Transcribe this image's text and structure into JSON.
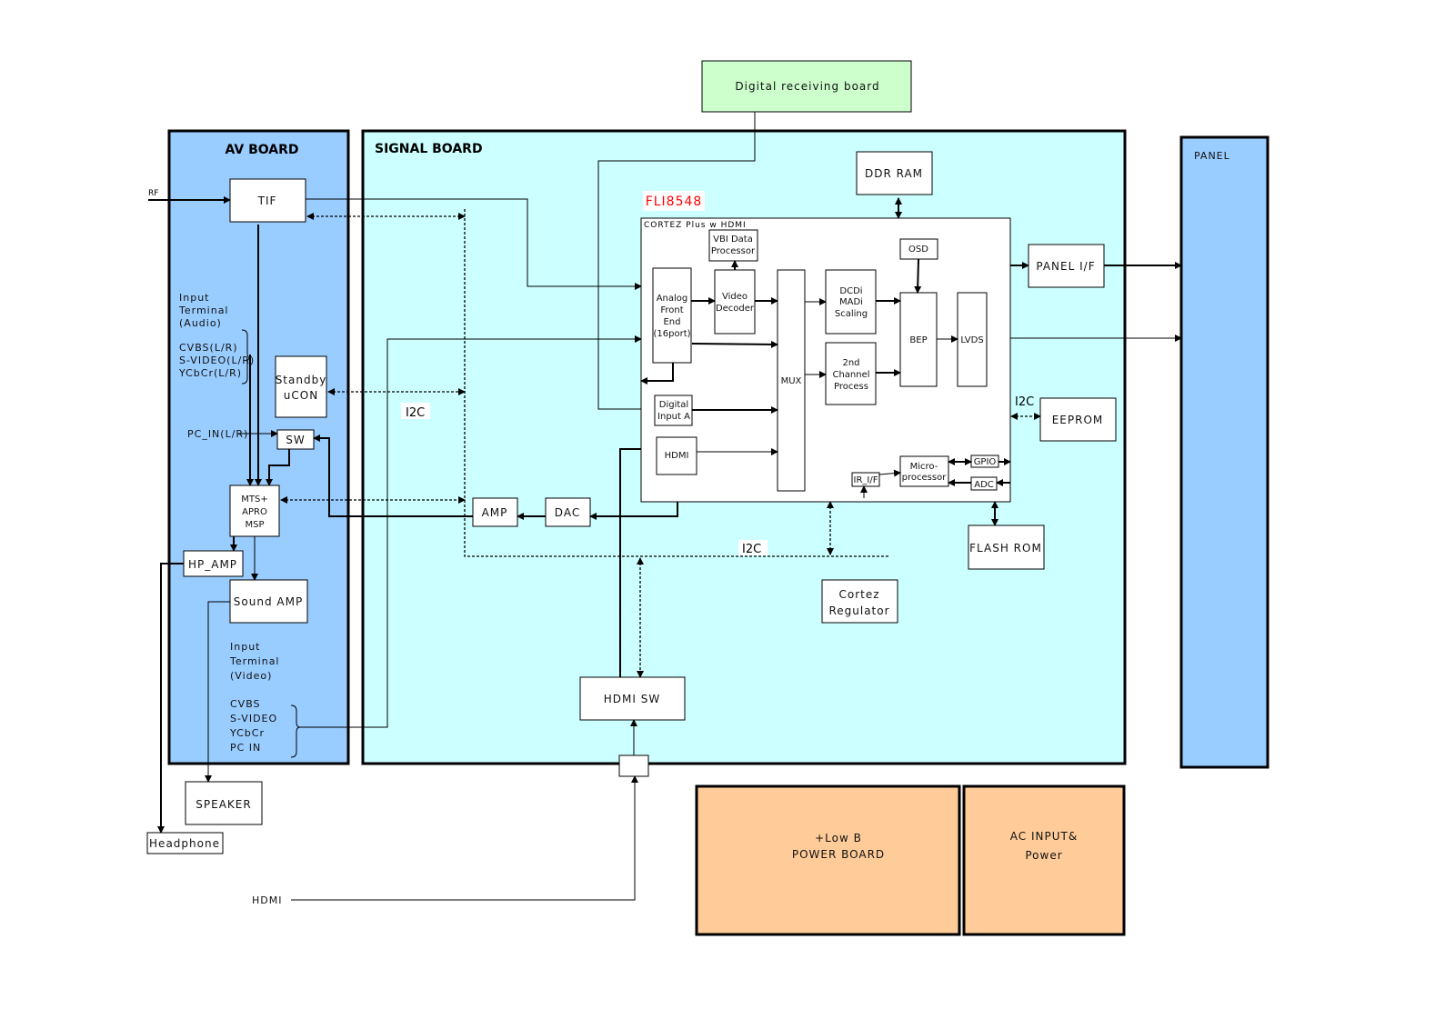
{
  "boards": {
    "digital_receiving": "Digital receiving board",
    "av": "AV BOARD",
    "signal": "SIGNAL BOARD",
    "panel": "PANEL",
    "power": [
      "+Low B",
      "POWER BOARD"
    ],
    "ac": [
      "AC INPUT&",
      "Power"
    ]
  },
  "av_blocks": {
    "tif": "TIF",
    "standby": [
      "Standby",
      "uCON"
    ],
    "sw": "SW",
    "mts": [
      "MTS+",
      "APRO",
      "MSP"
    ],
    "hp_amp": "HP_AMP",
    "sound_amp": "Sound AMP",
    "speaker": "SPEAKER",
    "headphone": "Headphone"
  },
  "signal_blocks": {
    "amp": "AMP",
    "dac": "DAC",
    "hdmi_sw": "HDMI SW",
    "ddr": "DDR RAM",
    "panel_if": "PANEL I/F",
    "eeprom": "EEPROM",
    "flash": "FLASH ROM",
    "regulator": [
      "Cortez",
      "Regulator"
    ]
  },
  "chip": {
    "part": "FLI8548",
    "part_color": "#ff0000",
    "name": "CORTEZ Plus w HDMI",
    "vbi": [
      "VBI Data",
      "Processor"
    ],
    "afe": [
      "Analog",
      "Front",
      "End",
      "(16port)"
    ],
    "video_decoder": [
      "Video",
      "Decoder"
    ],
    "mux": "MUX",
    "dcdi": [
      "DCDi",
      "MADi",
      "Scaling"
    ],
    "second": [
      "2nd",
      "Channel",
      "Process"
    ],
    "osd": "OSD",
    "bep": "BEP",
    "lvds": "LVDS",
    "digital_input": [
      "Digital",
      "Input A"
    ],
    "hdmi": "HDMI",
    "ir": "IR_I/F",
    "micro": [
      "Micro-",
      "processor"
    ],
    "gpio": "GPIO",
    "adc": "ADC"
  },
  "labels": {
    "rf": "RF",
    "audio_terminal": [
      "Input",
      "Terminal",
      "(Audio)"
    ],
    "audio_inputs": [
      "CVBS(L/R)",
      "S-VIDEO(L/R)",
      "YCbCr(L/R)"
    ],
    "pc_in": "PC_IN(L/R)",
    "video_terminal": [
      "Input",
      "Terminal",
      "(Video)"
    ],
    "video_inputs": [
      "CVBS",
      "S-VIDEO",
      "YCbCr",
      "PC IN"
    ],
    "i2c_1": "I2C",
    "i2c_2": "I2C",
    "i2c_3": "I2C",
    "hdmi_in": "HDMI"
  },
  "colors": {
    "av_board": "#99ccff",
    "signal_board": "#ccffff",
    "panel": "#99ccff",
    "digital_board": "#ccffcc",
    "power": "#ffcc99"
  }
}
